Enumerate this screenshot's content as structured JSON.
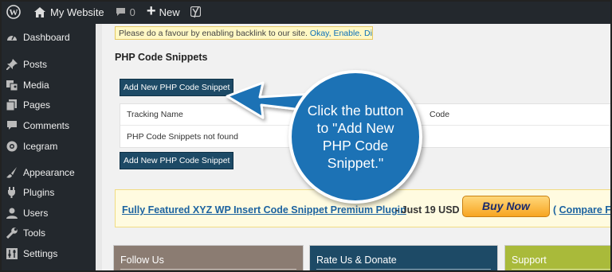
{
  "adminbar": {
    "site_name": "My Website",
    "comments_count": "0",
    "new_label": "New",
    "icons": [
      "wordpress-logo-icon",
      "home-icon",
      "comment-icon",
      "plus-icon",
      "yoast-icon"
    ]
  },
  "sidebar": {
    "items": [
      {
        "label": "Dashboard",
        "icon": "dashboard-icon"
      },
      {
        "label": "Posts",
        "icon": "pin-icon"
      },
      {
        "label": "Media",
        "icon": "media-icon"
      },
      {
        "label": "Pages",
        "icon": "pages-icon"
      },
      {
        "label": "Comments",
        "icon": "comment-icon"
      },
      {
        "label": "Icegram",
        "icon": "icegram-icon"
      },
      {
        "label": "Appearance",
        "icon": "brush-icon"
      },
      {
        "label": "Plugins",
        "icon": "plug-icon"
      },
      {
        "label": "Users",
        "icon": "user-icon"
      },
      {
        "label": "Tools",
        "icon": "wrench-icon"
      },
      {
        "label": "Settings",
        "icon": "settings-icon"
      }
    ]
  },
  "notice": {
    "text": "Please do a favour by enabling backlink to our site.",
    "link1": "Okay, Enable.",
    "link2": "Dismiss."
  },
  "page": {
    "title": "PHP Code Snippets",
    "add_button": "Add New PHP Code Snippet"
  },
  "table": {
    "headers": [
      "Tracking Name",
      "Code"
    ],
    "empty_message": "PHP Code Snippets not found"
  },
  "promo": {
    "link_text": "Fully Featured XYZ WP Insert Code Snippet Premium Plugin",
    "price_text": "- Just 19 USD",
    "buy_button": "Buy Now",
    "compare_prefix": "(",
    "compare_text": "Compare Fea"
  },
  "panels": {
    "follow": "Follow Us",
    "rate": "Rate Us & Donate",
    "support": "Support"
  },
  "callout": {
    "text": "Click the button to \"Add New PHP Code Snippet.\""
  },
  "colors": {
    "adminbar_bg": "#23282d",
    "button_dark": "#1d4a66",
    "callout_blue": "#1c72b5",
    "follow_panel": "#8b7c72",
    "support_panel": "#a9ba3a",
    "buy_now_orange": "#f7a521"
  }
}
